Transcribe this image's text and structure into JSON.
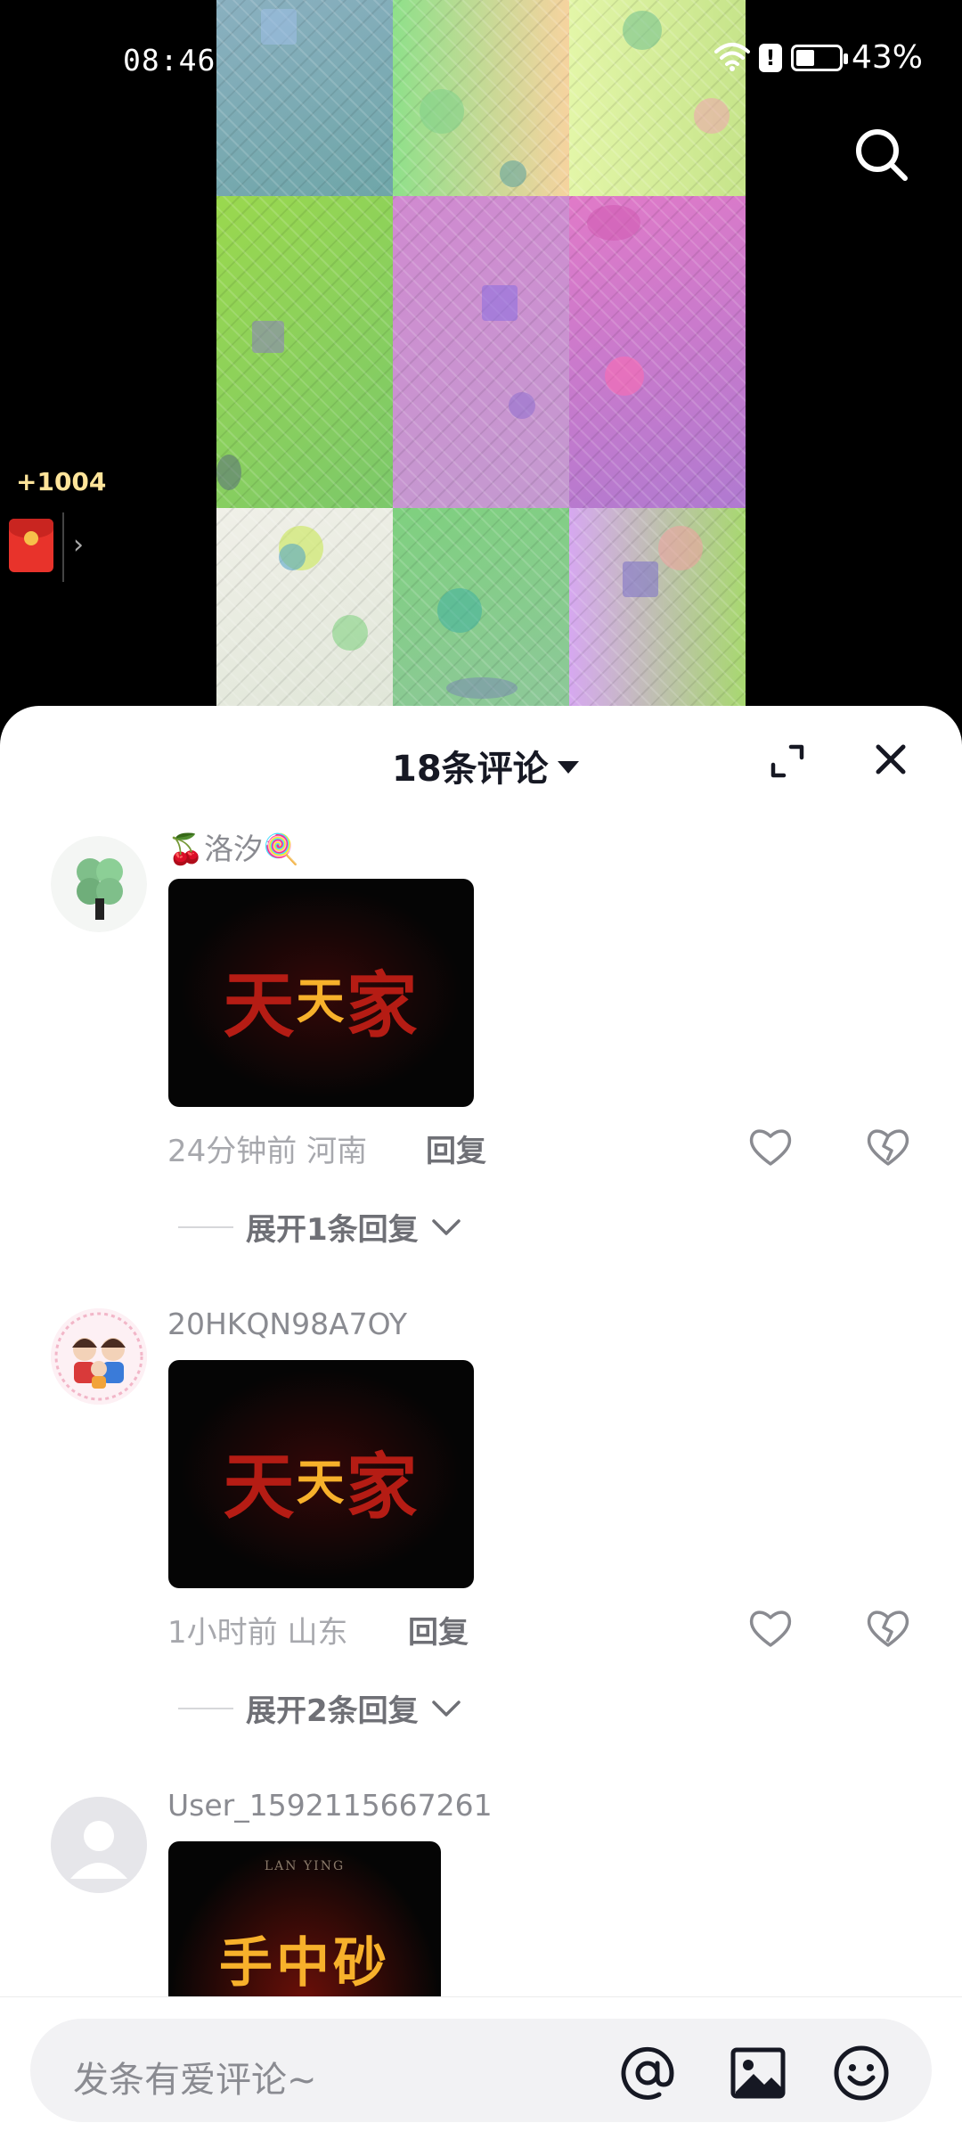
{
  "status_bar": {
    "time": "08:46",
    "battery_percent": "43%",
    "battery_level": 0.43
  },
  "video": {
    "search_icon": "search-icon",
    "reward": {
      "amount": "+1004",
      "icon": "red-packet-icon"
    }
  },
  "comments_sheet": {
    "title": "18条评论",
    "expand_icon": "expand-icon",
    "close_icon": "close-icon",
    "comments": [
      {
        "username": "🍒洛汐🍭",
        "image_text": [
          "天",
          "天",
          "家"
        ],
        "time": "24分钟前",
        "location": "河南",
        "reply_label": "回复",
        "expand_label": "展开1条回复"
      },
      {
        "username": "20HKQN98A7OY",
        "image_text": [
          "天",
          "天",
          "家"
        ],
        "time": "1小时前",
        "location": "山东",
        "reply_label": "回复",
        "expand_label": "展开2条回复"
      },
      {
        "username": "User_1592115667261",
        "image_caption": "LAN YING",
        "image_text": "手中砂"
      }
    ]
  },
  "input_bar": {
    "placeholder": "发条有爱评论~",
    "icons": [
      "at-icon",
      "image-icon",
      "emoji-icon"
    ]
  },
  "colors": {
    "text_primary": "#161823",
    "text_secondary": "#8a8b91",
    "accent_red": "#e8332b",
    "sheet_bg": "#ffffff"
  }
}
